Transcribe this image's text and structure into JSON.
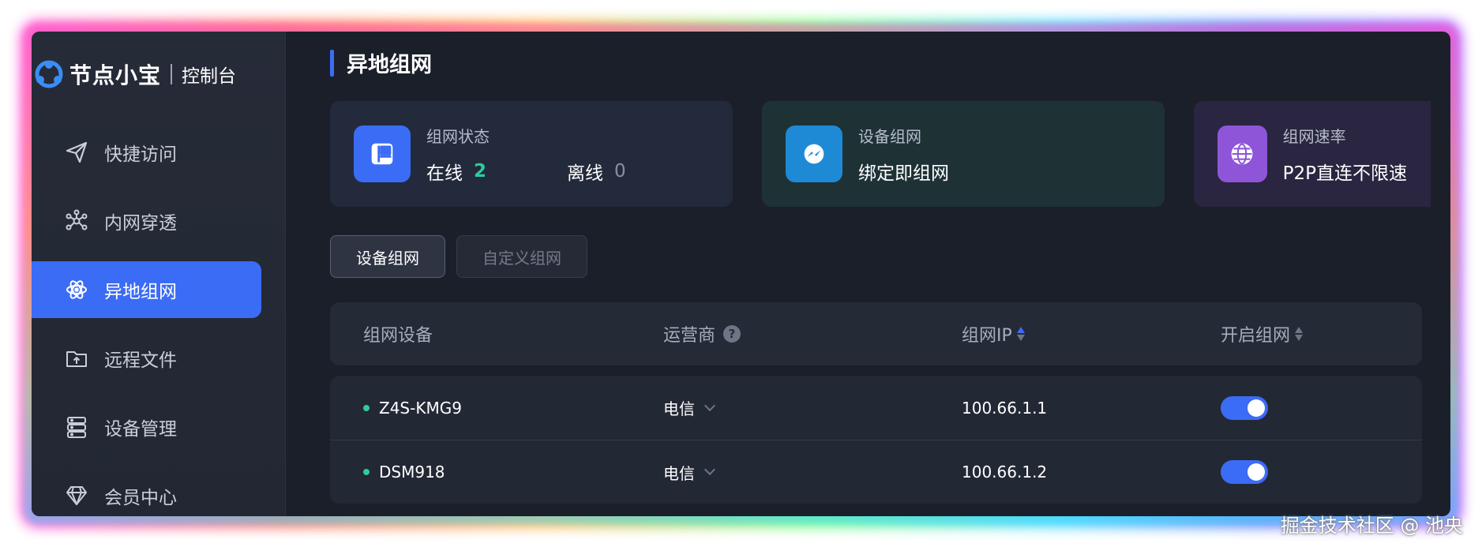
{
  "brand": {
    "name": "节点小宝",
    "sub": "控制台"
  },
  "sidebar": {
    "items": [
      {
        "label": "快捷访问",
        "icon": "send-icon"
      },
      {
        "label": "内网穿透",
        "icon": "network-icon"
      },
      {
        "label": "异地组网",
        "icon": "atom-icon",
        "active": true
      },
      {
        "label": "远程文件",
        "icon": "folder-upload-icon"
      },
      {
        "label": "设备管理",
        "icon": "server-icon"
      },
      {
        "label": "会员中心",
        "icon": "diamond-icon"
      }
    ]
  },
  "page": {
    "title": "异地组网"
  },
  "cards": [
    {
      "label": "组网状态",
      "online_label": "在线",
      "online_value": "2",
      "offline_label": "离线",
      "offline_value": "0",
      "icon": "layout-icon",
      "color": "#3b6cf6"
    },
    {
      "label": "设备组网",
      "value": "绑定即组网",
      "icon": "messenger-icon",
      "color": "#1e8ad6"
    },
    {
      "label": "组网速率",
      "value": "P2P直连不限速",
      "icon": "globe-icon",
      "color": "#8e55d9"
    }
  ],
  "tabs": [
    {
      "label": "设备组网",
      "active": true
    },
    {
      "label": "自定义组网",
      "active": false
    }
  ],
  "table": {
    "headers": {
      "device": "组网设备",
      "isp": "运营商",
      "ip": "组网IP",
      "enable": "开启组网"
    },
    "help": "?",
    "rows": [
      {
        "device": "Z4S-KMG9",
        "isp": "电信",
        "ip": "100.66.1.1",
        "enabled": true
      },
      {
        "device": "DSM918",
        "isp": "电信",
        "ip": "100.66.1.2",
        "enabled": true
      }
    ]
  },
  "watermark": "掘金技术社区 @ 池央"
}
